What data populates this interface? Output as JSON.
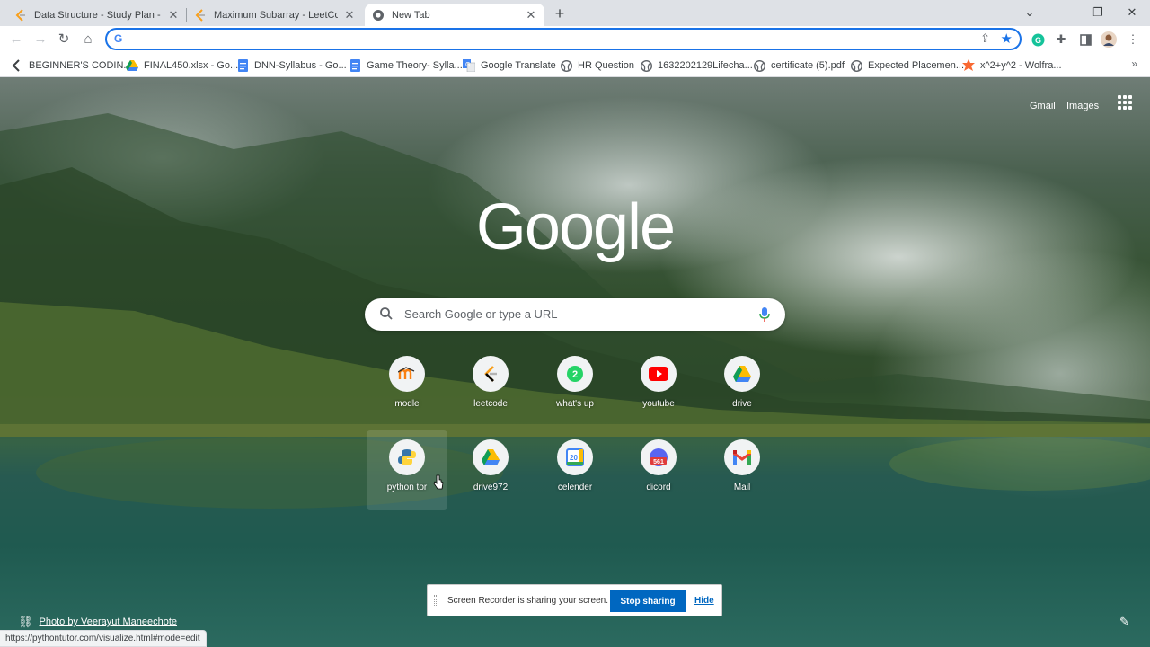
{
  "tabs": [
    {
      "title": "Data Structure - Study Plan - LeetCode",
      "favicon": "leetcode-icon",
      "active": false
    },
    {
      "title": "Maximum Subarray - LeetCode",
      "favicon": "leetcode-icon",
      "active": false
    },
    {
      "title": "New Tab",
      "favicon": "chrome-icon",
      "active": true
    }
  ],
  "toolbar": {
    "omnibox_value": "",
    "omnibox_prefix": "G",
    "extensions": [
      "grammarly-icon",
      "puzzle-icon",
      "sidepanel-icon",
      "profile-avatar",
      "more-icon"
    ]
  },
  "bookmarks": [
    {
      "label": "BEGINNER'S CODIN...",
      "icon": "leetcode-icon"
    },
    {
      "label": "FINAL450.xlsx - Go...",
      "icon": "drive-icon"
    },
    {
      "label": "DNN-Syllabus - Go...",
      "icon": "docs-icon"
    },
    {
      "label": "Game Theory- Sylla...",
      "icon": "docs-icon"
    },
    {
      "label": "Google Translate",
      "icon": "translate-icon"
    },
    {
      "label": "HR Question",
      "icon": "globe-icon"
    },
    {
      "label": "1632202129Lifecha...",
      "icon": "globe-icon"
    },
    {
      "label": "certificate (5).pdf",
      "icon": "globe-icon"
    },
    {
      "label": "Expected Placemen...",
      "icon": "globe-icon"
    },
    {
      "label": "x^2+y^2 - Wolfra...",
      "icon": "wolfram-icon"
    }
  ],
  "ntp": {
    "gmail": "Gmail",
    "images": "Images",
    "logo": "Google",
    "search_placeholder": "Search Google or type a URL",
    "shortcuts": [
      {
        "label": "modle",
        "icon": "moodle-icon"
      },
      {
        "label": "leetcode",
        "icon": "leetcode-icon"
      },
      {
        "label": "what's up",
        "icon": "whatsapp-icon"
      },
      {
        "label": "youtube",
        "icon": "youtube-icon"
      },
      {
        "label": "drive",
        "icon": "drive-icon"
      },
      {
        "label": "python tor",
        "icon": "python-icon"
      },
      {
        "label": "drive972",
        "icon": "drive-icon"
      },
      {
        "label": "celender",
        "icon": "calendar-icon"
      },
      {
        "label": "dicord",
        "icon": "discord-icon"
      },
      {
        "label": "Mail",
        "icon": "gmail-icon"
      }
    ],
    "calendar_day": "20",
    "discord_badge": "561",
    "whatsapp_badge": "2",
    "photo_credit": "Photo by Veerayut Maneechote"
  },
  "share_bar": {
    "message": "Screen Recorder is sharing your screen.",
    "stop_label": "Stop sharing",
    "hide_label": "Hide"
  },
  "status_url": "https://pythontutor.com/visualize.html#mode=edit",
  "colors": {
    "accent": "#1a73e8",
    "stop_button": "#0067c0",
    "youtube": "#ff0000"
  }
}
